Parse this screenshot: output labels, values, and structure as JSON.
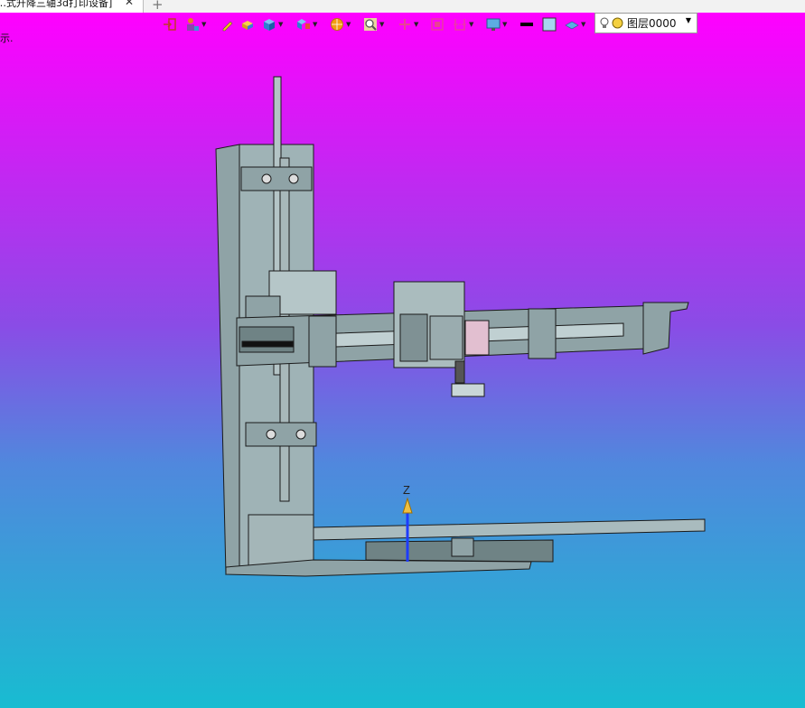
{
  "tab": {
    "title": "…式升降三轴3d打印设备]",
    "close": "✕",
    "new_tab": "+"
  },
  "viewport": {
    "hint": "示.",
    "axis_label": "Z"
  },
  "toolbar": {
    "icons": [
      "exit-icon",
      "person-settings-icon",
      "pencil-icon",
      "box-yellow-icon",
      "cube-icon",
      "cube-split-icon",
      "sphere-icon",
      "magnifier-icon",
      "axis-icon",
      "fit-view-icon",
      "section-icon",
      "display-icon",
      "black-line",
      "fill-color",
      "layer-plane-icon"
    ],
    "layer_label": "图层0000"
  },
  "colors": {
    "bg_top": "#ff00ff",
    "bg_bottom": "#18bcd1",
    "model": "#8fa3a6",
    "edge": "#1a1a1a"
  }
}
